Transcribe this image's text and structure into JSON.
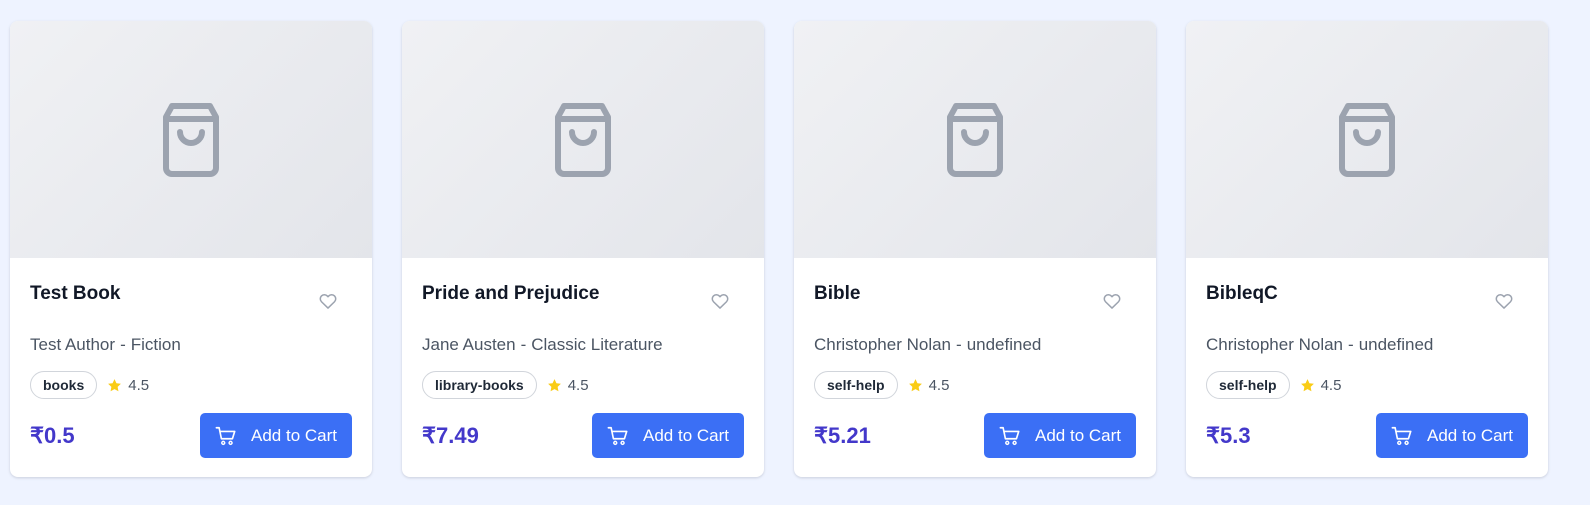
{
  "products": [
    {
      "title": "Test Book",
      "author": "Test Author",
      "separator": "-",
      "category": "Fiction",
      "tag": "books",
      "rating": "4.5",
      "price": "₹0.5",
      "button_label": "Add to Cart",
      "image_icon": "shopping-bag-icon"
    },
    {
      "title": "Pride and Prejudice",
      "author": "Jane Austen",
      "separator": "-",
      "category": "Classic Literature",
      "tag": "library-books",
      "rating": "4.5",
      "price": "₹7.49",
      "button_label": "Add to Cart",
      "image_icon": "shopping-bag-icon"
    },
    {
      "title": "Bible",
      "author": "Christopher Nolan",
      "separator": "-",
      "category": "undefined",
      "tag": "self-help",
      "rating": "4.5",
      "price": "₹5.21",
      "button_label": "Add to Cart",
      "image_icon": "shopping-bag-icon"
    },
    {
      "title": "BibleqC",
      "author": "Christopher Nolan",
      "separator": "-",
      "category": "undefined",
      "tag": "self-help",
      "rating": "4.5",
      "price": "₹5.3",
      "button_label": "Add to Cart",
      "image_icon": "shopping-bag-icon"
    }
  ],
  "icons": {
    "favorite": "heart-icon",
    "rating": "star-icon",
    "cart": "shopping-cart-icon"
  },
  "colors": {
    "page_background": "#eef3ff",
    "accent_button": "#3b6ff5",
    "price": "#4338ca",
    "star": "#facc15",
    "placeholder_icon": "#9ca3af"
  }
}
